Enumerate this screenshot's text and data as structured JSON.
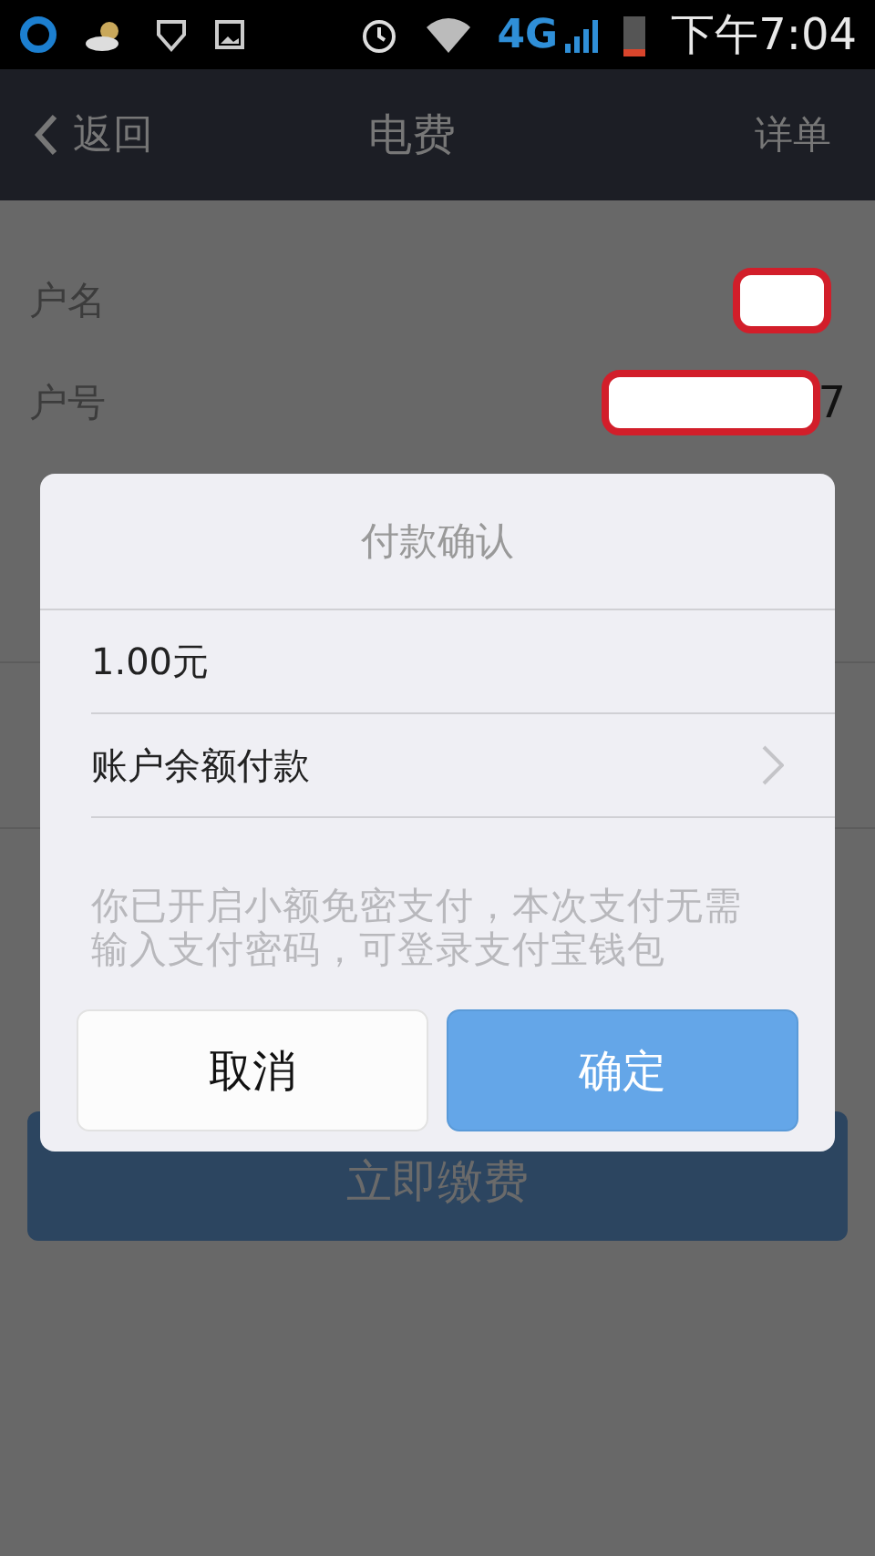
{
  "status_bar": {
    "time": "下午7:04",
    "network": "4G"
  },
  "header": {
    "back": "返回",
    "title": "电费",
    "action": "详单"
  },
  "fields": [
    {
      "label": "户名",
      "redacted": true
    },
    {
      "label": "户号",
      "value": "7",
      "redacted": true
    }
  ],
  "pay_button": {
    "label": "立即缴费"
  },
  "dialog": {
    "title": "付款确认",
    "amount": "1.00元",
    "method": "账户余额付款",
    "message": "你已开启小额免密支付，本次支付无需输入支付密码，可登录支付宝钱包",
    "buttons": [
      {
        "label": "取消",
        "kind": "secondary"
      },
      {
        "label": "确定",
        "kind": "primary"
      }
    ]
  }
}
